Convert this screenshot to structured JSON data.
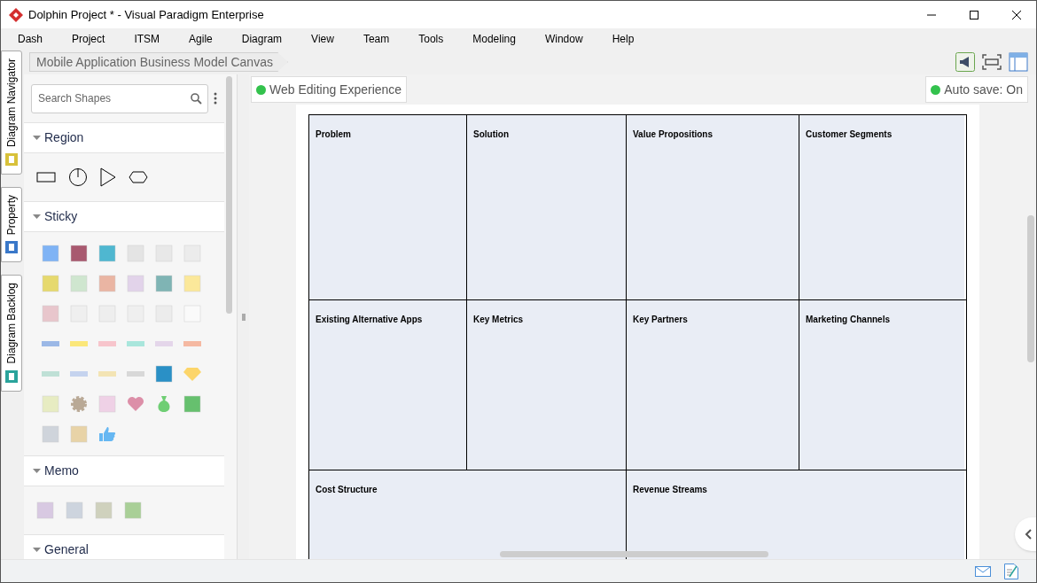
{
  "window": {
    "title": "Dolphin Project * - Visual Paradigm Enterprise"
  },
  "menu": [
    "Dash",
    "Project",
    "ITSM",
    "Agile",
    "Diagram",
    "View",
    "Team",
    "Tools",
    "Modeling",
    "Window",
    "Help"
  ],
  "side_tabs": [
    "Diagram Navigator",
    "Property",
    "Diagram Backlog"
  ],
  "breadcrumb": "Mobile Application Business Model Canvas",
  "palette": {
    "search": {
      "placeholder": "Search Shapes"
    },
    "sections": [
      {
        "title": "Region",
        "expanded": true,
        "kind": "region"
      },
      {
        "title": "Sticky",
        "expanded": true,
        "kind": "sticky"
      },
      {
        "title": "Memo",
        "expanded": true,
        "kind": "memo"
      },
      {
        "title": "General",
        "expanded": true,
        "kind": "none"
      }
    ]
  },
  "web_editing": "Web Editing Experience",
  "auto_save": "Auto save: On",
  "canvas": {
    "regions": [
      "Problem",
      "Solution",
      "Value Propositions",
      "Customer Segments",
      "Existing Alternative Apps",
      "Key Metrics",
      "Key Partners",
      "Marketing Channels",
      "Cost Structure",
      "Revenue Streams"
    ]
  }
}
